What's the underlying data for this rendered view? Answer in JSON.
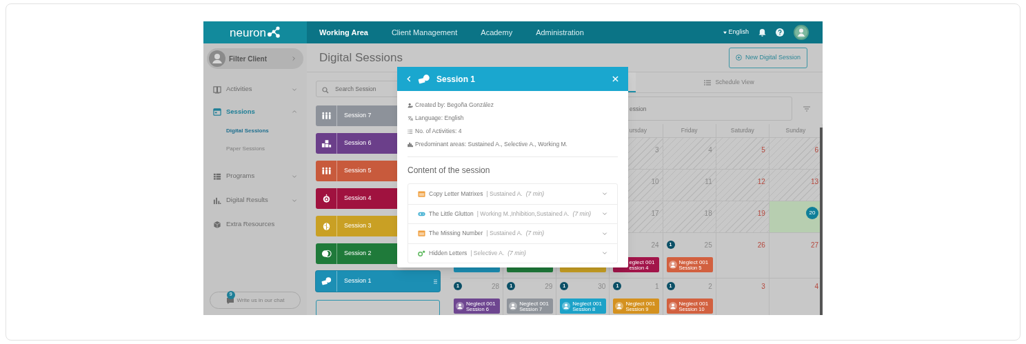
{
  "topbar": {
    "logo": "neuron",
    "nav": [
      {
        "label": "Working Area",
        "selected": true
      },
      {
        "label": "Client Management",
        "selected": false
      },
      {
        "label": "Academy",
        "selected": false
      },
      {
        "label": "Administration",
        "selected": false
      }
    ],
    "language": "English"
  },
  "sidebar": {
    "filter_label": "Filter Client",
    "items": [
      {
        "label": "Activities",
        "selected": false,
        "expanded": false
      },
      {
        "label": "Sessions",
        "selected": true,
        "expanded": true,
        "children": [
          {
            "label": "Digital Sessions",
            "selected": true
          },
          {
            "label": "Paper Sessions",
            "selected": false
          }
        ]
      },
      {
        "label": "Programs",
        "selected": false,
        "expanded": false
      },
      {
        "label": "Digital Results",
        "selected": false,
        "expanded": false
      },
      {
        "label": "Extra Resources",
        "selected": false
      }
    ],
    "chat": {
      "label": "Write us in our chat",
      "badge": "9"
    }
  },
  "page": {
    "title": "Digital Sessions",
    "new_button": "New Digital Session"
  },
  "sessions": {
    "search": {
      "placeholder": "Search Session"
    },
    "items": [
      {
        "label": "Session 7",
        "color": "#8d929a",
        "selected": false
      },
      {
        "label": "Session 6",
        "color": "#6b3f8a",
        "selected": false
      },
      {
        "label": "Session 5",
        "color": "#c85a3c",
        "selected": false
      },
      {
        "label": "Session 4",
        "color": "#a0123f",
        "selected": false
      },
      {
        "label": "Session 3",
        "color": "#c9a024",
        "selected": false
      },
      {
        "label": "Session 2",
        "color": "#1f7a3a",
        "selected": false
      },
      {
        "label": "Session 1",
        "color": "#1c8fb4",
        "selected": true
      }
    ]
  },
  "calendar": {
    "tabs": [
      {
        "selected": true
      },
      {
        "label": "Schedule View",
        "selected": false
      }
    ],
    "search": {
      "placeholder": "ession"
    },
    "weekdays": [
      {
        "label": "ursday",
        "kind": "partial"
      },
      {
        "label": "Friday",
        "kind": "full"
      },
      {
        "label": "Saturday",
        "kind": "full"
      },
      {
        "label": "Sunday",
        "kind": "full"
      }
    ],
    "weeks": [
      [
        {
          "date": "3",
          "past": true,
          "today": false
        },
        {
          "date": "4",
          "past": true,
          "today": false
        },
        {
          "date": "5",
          "past": true,
          "today": false
        },
        {
          "date": "6",
          "past": true,
          "today": false
        }
      ],
      [
        {
          "date": "10",
          "past": true,
          "today": false
        },
        {
          "date": "11",
          "past": true,
          "today": false
        },
        {
          "date": "12",
          "past": true,
          "today": false
        },
        {
          "date": "13",
          "past": true,
          "today": false
        }
      ],
      [
        {
          "date": "17",
          "past": true,
          "today": false
        },
        {
          "date": "18",
          "past": true,
          "today": false
        },
        {
          "date": "19",
          "past": true,
          "today": false
        },
        {
          "date": "20",
          "past": false,
          "today": true
        }
      ],
      [
        {
          "past": false,
          "today": false,
          "events": [
            {
              "kind": "hidden",
              "color": "#1c8fb4"
            }
          ]
        },
        {
          "past": false,
          "today": false,
          "events": [
            {
              "kind": "hidden",
              "color": "#1f7a3a"
            }
          ]
        },
        {
          "past": false,
          "today": false,
          "events": [
            {
              "kind": "hidden",
              "color": "#c9a024"
            }
          ]
        },
        {
          "date": "24",
          "past": false,
          "today": false,
          "events": [
            {
              "kind": "partial",
              "title": "eglect 001",
              "subtitle": "ession 4",
              "color": "#a2154a"
            }
          ]
        },
        {
          "date": "25",
          "past": false,
          "today": false,
          "badge": "1",
          "events": [
            {
              "kind": "full",
              "title": "Neglect 001",
              "subtitle": "Session 5",
              "color": "#d2603f"
            }
          ]
        },
        {
          "date": "26",
          "past": false,
          "today": false
        },
        {
          "date": "27",
          "past": false,
          "today": false
        }
      ],
      [
        {
          "date": "28",
          "past": false,
          "today": false,
          "badge": "1",
          "events": [
            {
              "kind": "full",
              "title": "Neglect 001",
              "subtitle": "Session 6",
              "color": "#6e4690"
            }
          ]
        },
        {
          "date": "29",
          "past": false,
          "today": false,
          "badge": "1",
          "events": [
            {
              "kind": "full",
              "title": "Neglect 001",
              "subtitle": "Session 7",
              "color": "#8f949b"
            }
          ]
        },
        {
          "date": "30",
          "past": false,
          "today": false,
          "badge": "1",
          "events": [
            {
              "kind": "full",
              "title": "Neglect 001",
              "subtitle": "Session 8",
              "color": "#1ca2c8"
            }
          ]
        },
        {
          "date": "1",
          "past": false,
          "today": false,
          "badge": "1",
          "events": [
            {
              "kind": "full",
              "title": "Neglect 001",
              "subtitle": "Session 9",
              "color": "#d4911f"
            }
          ]
        },
        {
          "date": "2",
          "past": false,
          "today": false,
          "badge": "1",
          "events": [
            {
              "kind": "full",
              "title": "Neglect 001",
              "subtitle": "Session 10",
              "color": "#d2603f"
            }
          ]
        },
        {
          "date": "3",
          "past": false,
          "today": false
        },
        {
          "date": "4",
          "past": false,
          "today": false
        }
      ]
    ]
  },
  "modal": {
    "title": "Session 1",
    "details": [
      "Created by: Begoña González",
      "Language: English",
      "No. of Activities: 4",
      "Predominant areas: Sustained A., Selective A., Working M."
    ],
    "content_heading": "Content of the session",
    "activities": [
      {
        "name": "Copy Letter Matrixes",
        "areas": "| Sustained A.",
        "duration": "(7 min)",
        "color": "#f0a040"
      },
      {
        "name": "The Little Glutton",
        "areas": "| Working M.,Inhibition,Sustained A.",
        "duration": "(7 min)",
        "color": "#4ab3d4"
      },
      {
        "name": "The Missing Number",
        "areas": "| Sustained A.",
        "duration": "(7 min)",
        "color": "#f0a040"
      },
      {
        "name": "Hidden Letters",
        "areas": "| Selective A.",
        "duration": "(7 min)",
        "color": "#5cb85c"
      }
    ]
  }
}
